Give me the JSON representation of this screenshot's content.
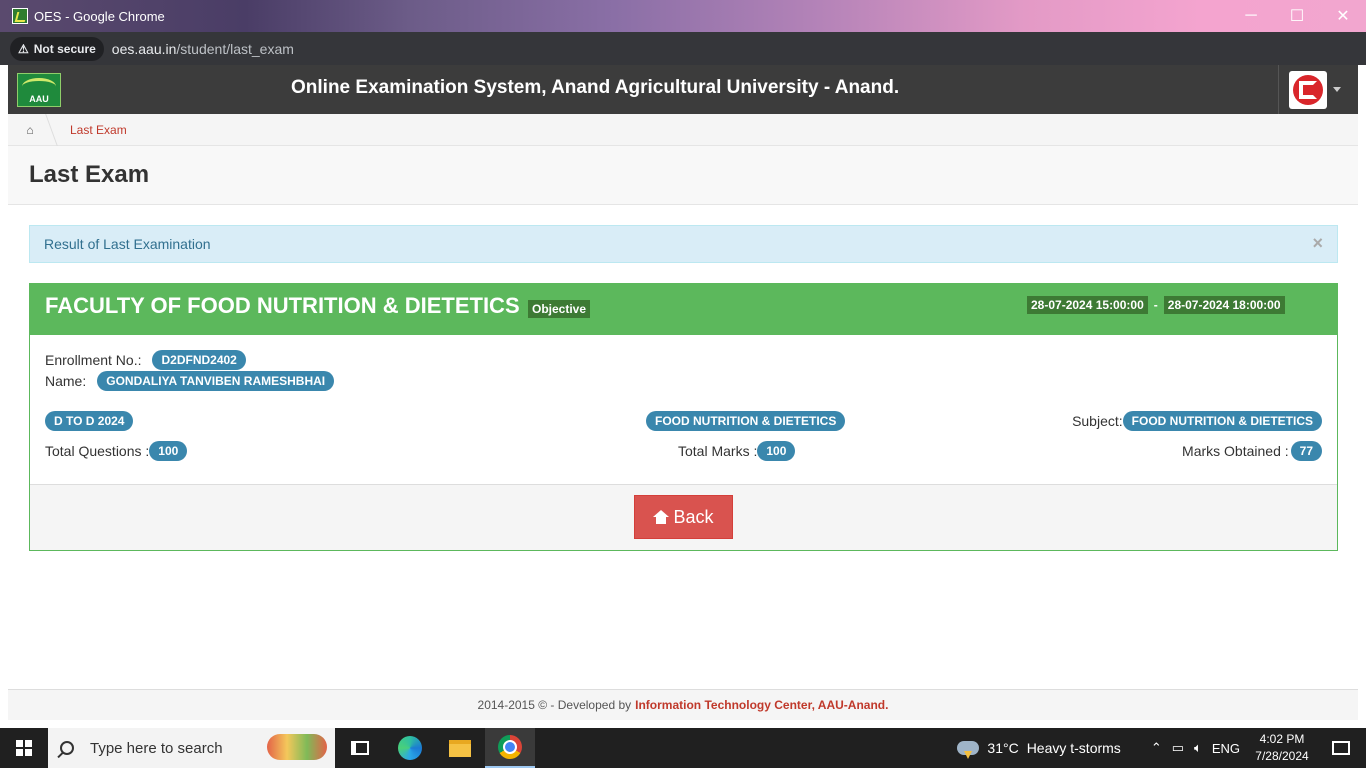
{
  "browser": {
    "window_title": "OES - Google Chrome",
    "security_label": "Not secure",
    "url_host": "oes.aau.in",
    "url_path": "/student/last_exam",
    "minimize": "─",
    "maximize": "☐",
    "close": "✕"
  },
  "header": {
    "logo_text": "AAU",
    "app_title": "Online Examination System, Anand Agricultural University - Anand."
  },
  "breadcrumb": {
    "home_icon": "home-icon",
    "current": "Last Exam"
  },
  "page": {
    "title": "Last Exam"
  },
  "alert": {
    "message": "Result of Last Examination",
    "close": "×"
  },
  "exam": {
    "faculty": "FACULTY OF FOOD NUTRITION & DIETETICS",
    "type": "Objective",
    "start": "28-07-2024 15:00:00",
    "separator": "-",
    "end": "28-07-2024 18:00:00",
    "enrollment_label": "Enrollment No.:",
    "enrollment": "D2DFND2402",
    "name_label": "Name:",
    "name": "GONDALIYA TANVIBEN RAMESHBHAI",
    "batch": "D TO D 2024",
    "course": "FOOD NUTRITION & DIETETICS",
    "subject_label": "Subject:",
    "subject": "FOOD NUTRITION & DIETETICS",
    "total_questions_label": "Total Questions :",
    "total_questions": "100",
    "total_marks_label": "Total Marks :",
    "total_marks": "100",
    "marks_obtained_label": "Marks Obtained :",
    "marks_obtained": "77",
    "back_label": "Back"
  },
  "footer": {
    "text": "2014-2015 © - Developed by",
    "org": "Information Technology Center, AAU-Anand."
  },
  "taskbar": {
    "search_placeholder": "Type here to search",
    "temperature": "31°C",
    "weather": "Heavy t-storms",
    "language": "ENG",
    "time": "4:02 PM",
    "date": "7/28/2024"
  },
  "colors": {
    "panel_green": "#5cb85c",
    "badge_blue": "#3a87ad",
    "back_red": "#d9534f",
    "alert_bg": "#d9edf7"
  }
}
